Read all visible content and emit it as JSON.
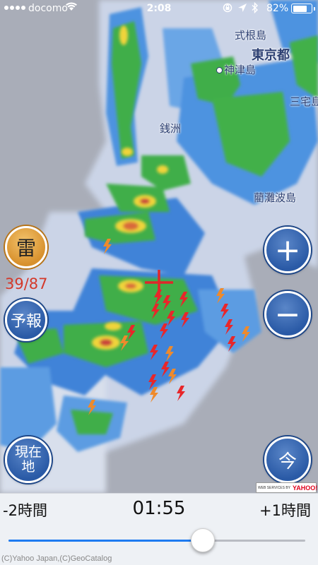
{
  "status_bar": {
    "carrier": "docomo",
    "time": "2:08",
    "battery_percent_text": "82%",
    "battery_level": 0.82
  },
  "map": {
    "places": {
      "shikinejima": "式根島",
      "tokyo": "東京都",
      "kozushima": "神津島",
      "miyakejima": "三宅島",
      "zenisu": "銭洲",
      "ranbaba": "藺灘波島"
    }
  },
  "controls": {
    "thunder_label": "雷",
    "strike_count": "39/87",
    "forecast_label": "予報",
    "current_location_label_line1": "現在",
    "current_location_label_line2": "地",
    "zoom_in_symbol": "+",
    "zoom_out_symbol": "−",
    "now_label": "今"
  },
  "attribution": {
    "badge_text": "WEB SERVICES BY",
    "badge_logo": "YAHOO!",
    "copyright": "(C)Yahoo Japan,(C)GeoCatalog"
  },
  "time_bar": {
    "minus_label": "-2時間",
    "current_time": "01:55",
    "plus_label": "+1時間",
    "slider_position": 0.655
  },
  "colors": {
    "accent": "#1e7bf0",
    "strike_red": "#e8262a",
    "strike_orange": "#ee8a2c",
    "thunder_button": "#d8912d",
    "button_blue": "#2a5aa6"
  }
}
